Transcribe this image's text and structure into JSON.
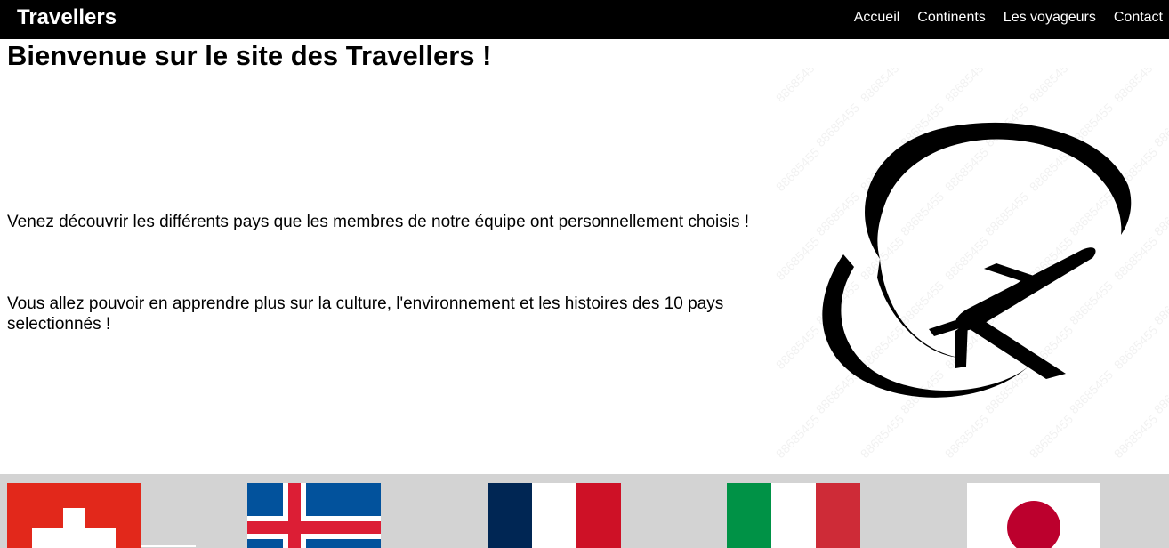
{
  "navbar": {
    "brand": "Travellers",
    "links": [
      {
        "label": "Accueil"
      },
      {
        "label": "Continents"
      },
      {
        "label": "Les voyageurs"
      },
      {
        "label": "Contact"
      }
    ]
  },
  "main": {
    "title": "Bienvenue sur le site des Travellers !",
    "paragraphs": [
      "Venez découvrir les différents pays que les membres de notre équipe ont personnellement choisis !",
      "Vous allez pouvoir en apprendre plus sur la culture, l'environnement et les histoires des 10 pays selectionnés !"
    ],
    "hero_image": {
      "icon": "airplane-globe-icon",
      "watermark": "88685455"
    }
  },
  "flags": [
    {
      "country": "switzerland",
      "icon": "flag-switzerland-icon"
    },
    {
      "country": "iceland",
      "icon": "flag-iceland-icon"
    },
    {
      "country": "france",
      "icon": "flag-france-icon"
    },
    {
      "country": "italy",
      "icon": "flag-italy-icon"
    },
    {
      "country": "japan",
      "icon": "flag-japan-icon"
    }
  ],
  "colors": {
    "navbar_bg": "#000000",
    "flags_bar_bg": "#d3d3d3",
    "swiss_red": "#e2281b",
    "iceland_blue": "#02529c",
    "iceland_red": "#dc1e35",
    "france_blue": "#002654",
    "france_red": "#ce1126",
    "italy_green": "#009246",
    "italy_red": "#ce2b37",
    "japan_red": "#bc002d"
  }
}
